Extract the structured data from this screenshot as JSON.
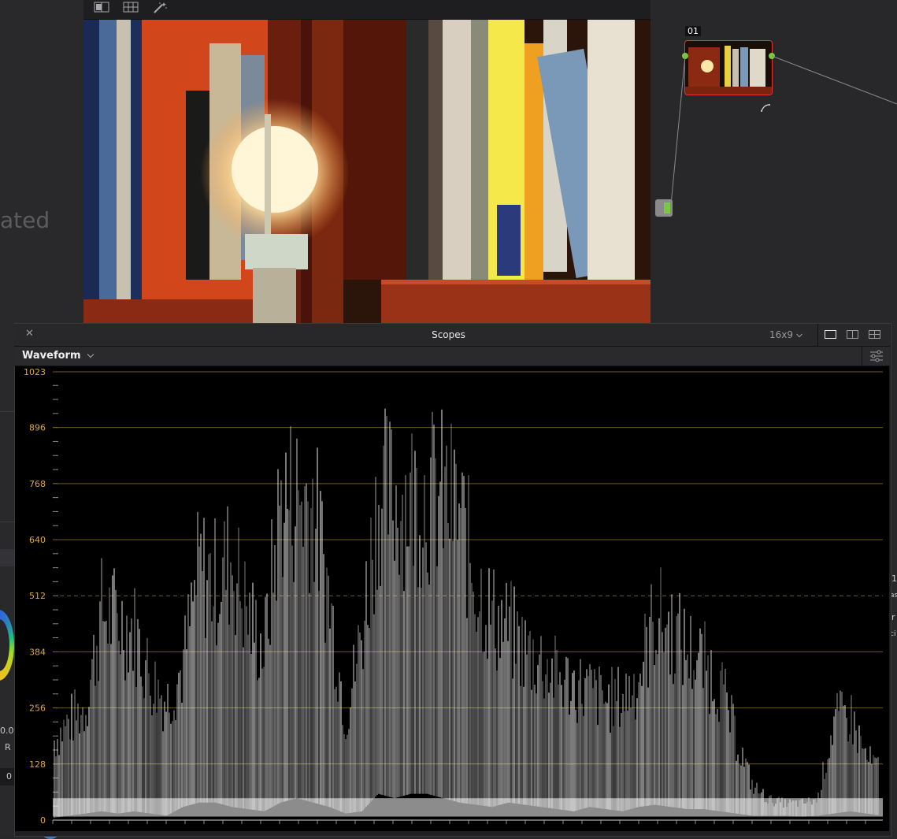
{
  "background": {
    "left_panel_text": "ated",
    "left_values": [
      "0.0",
      "R",
      "0"
    ],
    "right_values": [
      "1",
      "as",
      "r",
      "ci"
    ]
  },
  "viewer": {
    "toolbar_icons": [
      "split-view-icon",
      "grid-view-icon",
      "magic-wand-icon"
    ]
  },
  "node_editor": {
    "node_label": "01"
  },
  "scopes": {
    "title": "Scopes",
    "aspect": "16x9",
    "aspect_icon": "chevron-down-icon",
    "scope_type": "Waveform",
    "layout_icons": [
      "single-layout-icon",
      "dual-layout-icon",
      "quad-layout-icon"
    ],
    "settings_icon": "sliders-icon",
    "colors": {
      "grid": "#6e5a22",
      "label": "#d8a64a",
      "trace": "#ffffff"
    }
  },
  "chart_data": {
    "type": "waveform",
    "y_ticks": [
      1023,
      896,
      768,
      640,
      512,
      384,
      256,
      128,
      0
    ],
    "y_range": [
      0,
      1023
    ],
    "grid": true
  }
}
